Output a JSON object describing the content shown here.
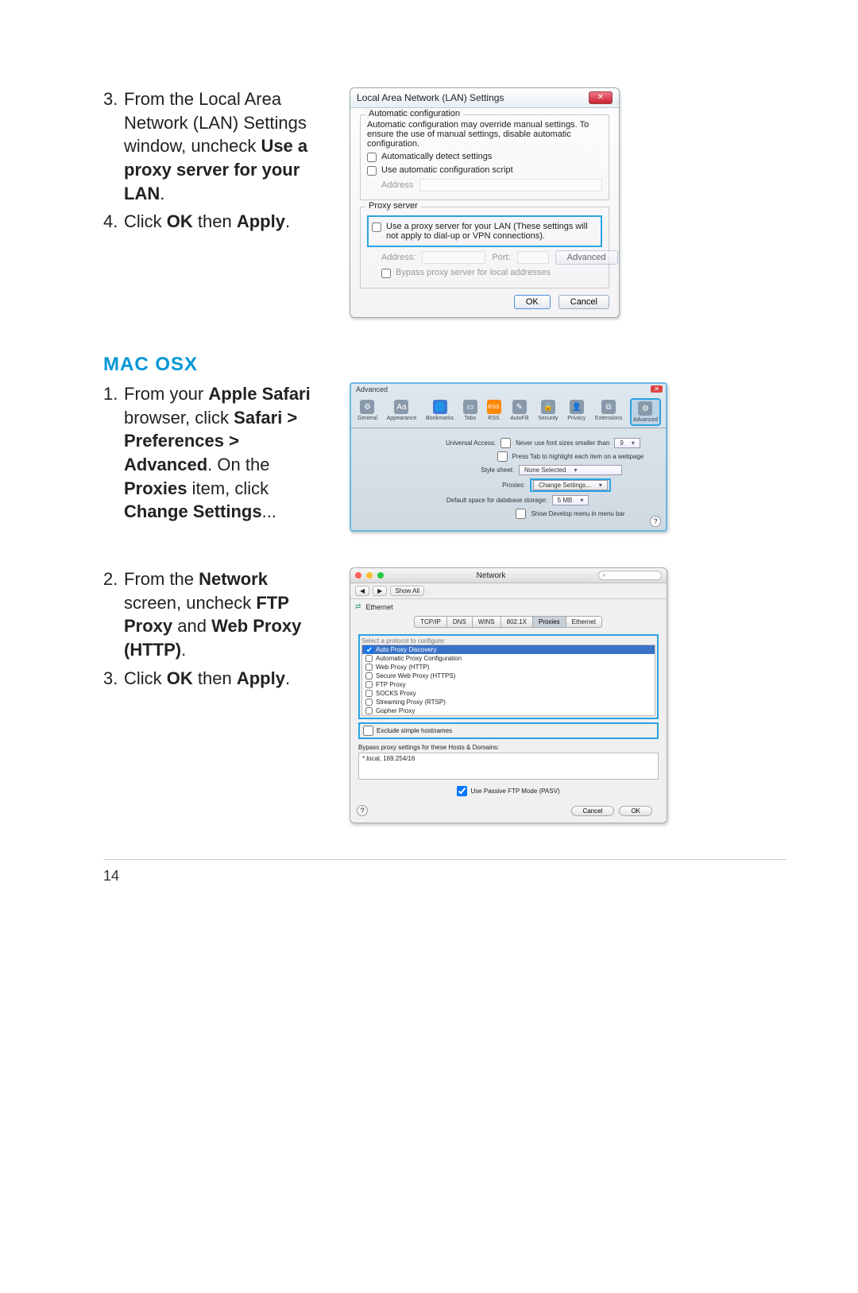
{
  "instructions1": {
    "item3": {
      "num": "3.",
      "t1": "From the Local Area Network (LAN) Settings window, uncheck ",
      "b1": "Use a proxy server for your LAN",
      "tail": "."
    },
    "item4": {
      "num": "4.",
      "t1": "Click ",
      "b1": "OK",
      "t2": " then ",
      "b2": "Apply",
      "tail": "."
    }
  },
  "macosx_heading": "MAC OSX",
  "instructions2": {
    "item1": {
      "num": "1.",
      "t1": "From your ",
      "b1": "Apple Safari",
      "t2": " browser, click ",
      "b2": "Safari > Preferences > Advanced",
      "t3": ". On the ",
      "b3": "Proxies",
      "t4": " item, click ",
      "b4": "Change Settings",
      "tail": "..."
    }
  },
  "instructions3": {
    "item2": {
      "num": "2.",
      "t1": "From the ",
      "b1": "Network",
      "t2": " screen, uncheck ",
      "b2": "FTP Proxy",
      "t3": " and ",
      "b3": "Web Proxy (HTTP)",
      "tail": "."
    },
    "item3": {
      "num": "3.",
      "t1": "Click ",
      "b1": "OK",
      "t2": " then ",
      "b2": "Apply",
      "tail": "."
    }
  },
  "lan": {
    "title": "Local Area Network (LAN) Settings",
    "auto": {
      "legend": "Automatic configuration",
      "desc": "Automatic configuration may override manual settings. To ensure the use of manual settings, disable automatic configuration.",
      "cb1": "Automatically detect settings",
      "cb2": "Use automatic configuration script",
      "addr": "Address"
    },
    "proxy": {
      "legend": "Proxy server",
      "cb": "Use a proxy server for your LAN (These settings will not apply to dial-up or VPN connections).",
      "addr": "Address:",
      "port": "Port:",
      "adv": "Advanced",
      "bypass": "Bypass proxy server for local addresses"
    },
    "ok": "OK",
    "cancel": "Cancel"
  },
  "saf": {
    "header": "Advanced",
    "tabs": [
      "General",
      "Appearance",
      "Bookmarks",
      "Tabs",
      "RSS",
      "AutoFill",
      "Security",
      "Privacy",
      "Extensions",
      "Advanced"
    ],
    "icons": [
      "⚙",
      "Aa",
      "🌐",
      "▭",
      "RSS",
      "✎",
      "🔒",
      "👤",
      "⧉",
      "⚙"
    ],
    "ua_label": "Universal Access:",
    "ua_cb1": "Never use font sizes smaller than",
    "ua_val": "9",
    "ua_cb2": "Press Tab to highlight each item on a webpage",
    "ss_label": "Style sheet:",
    "ss_val": "None Selected",
    "px_label": "Proxies:",
    "px_btn": "Change Settings...",
    "db_label": "Default space for database storage:",
    "db_val": "5 MB",
    "dev_cb": "Show Develop menu in menu bar",
    "help": "?"
  },
  "net": {
    "title": "Network",
    "showall": "Show All",
    "eth": "Ethernet",
    "seg": [
      "TCP/IP",
      "DNS",
      "WINS",
      "802.1X",
      "Proxies",
      "Ethernet"
    ],
    "seg_sel": 4,
    "configure": "Select a protocol to configure:",
    "prot": [
      "Auto Proxy Discovery",
      "Automatic Proxy Configuration",
      "Web Proxy (HTTP)",
      "Secure Web Proxy (HTTPS)",
      "FTP Proxy",
      "SOCKS Proxy",
      "Streaming Proxy (RTSP)",
      "Gopher Proxy"
    ],
    "prot_sel": 0,
    "exclude": "Exclude simple hostnames",
    "bypass_label": "Bypass proxy settings for these Hosts & Domains:",
    "bypass_val": "*.local, 169.254/16",
    "pasv": "Use Passive FTP Mode (PASV)",
    "cancel": "Cancel",
    "ok": "OK",
    "help": "?"
  },
  "page_number": "14"
}
